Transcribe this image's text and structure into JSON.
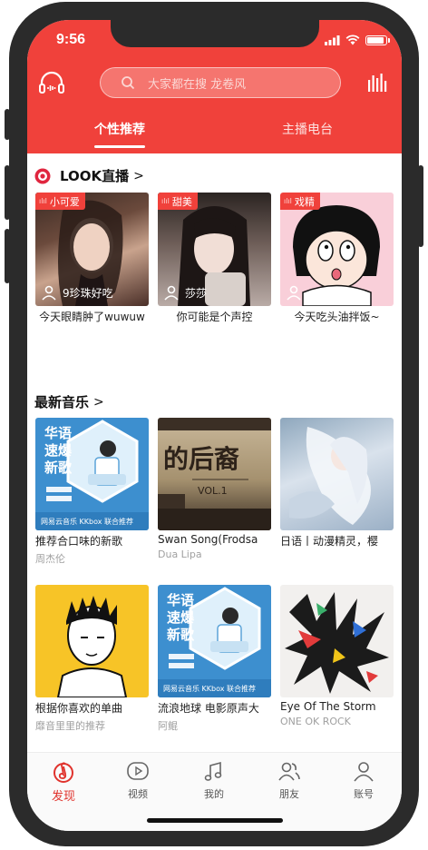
{
  "status_bar": {
    "time": "9:56"
  },
  "header": {
    "search_placeholder": "大家都在搜 龙卷风",
    "tabs": [
      {
        "label": "个性推荐",
        "active": true
      },
      {
        "label": "主播电台",
        "active": false
      }
    ]
  },
  "look": {
    "title": "LOOK直播",
    "arrow": ">",
    "cards": [
      {
        "tag": "小可爱",
        "name": "9珍珠好吃",
        "title": "今天眼睛肿了wuwuw"
      },
      {
        "tag": "甜美",
        "name": "莎莎",
        "title": "你可能是个声控"
      },
      {
        "tag": "戏精",
        "name": "",
        "title": "今天吃头油拌饭~"
      }
    ]
  },
  "music": {
    "title": "最新音乐",
    "arrow": ">",
    "cards": [
      {
        "title": "推荐合口味的新歌",
        "subtitle": "周杰伦",
        "cover": {
          "line1": "华语",
          "line2": "速爆",
          "line3": "新歌",
          "brand": "网易云音乐 KKbox 联合推荐"
        }
      },
      {
        "title": "Swan Song(Frodsa",
        "subtitle": "Dua Lipa",
        "cover": {
          "text1": "的后裔",
          "text2": "VOL.1"
        }
      },
      {
        "title": "日语丨动漫精灵，樱",
        "subtitle": ""
      },
      {
        "title": "根据你喜欢的单曲",
        "subtitle": "靡音里里的推荐"
      },
      {
        "title": "流浪地球 电影原声大",
        "subtitle": "阿鲲",
        "cover": {
          "line1": "华语",
          "line2": "速爆",
          "line3": "新歌",
          "brand": "网易云音乐 KKbox 联合推荐"
        }
      },
      {
        "title": "Eye Of The Storm",
        "subtitle": "ONE OK ROCK"
      }
    ]
  },
  "tabbar": {
    "items": [
      {
        "label": "发现",
        "icon": "netease-music-icon",
        "active": true
      },
      {
        "label": "视频",
        "icon": "video-icon",
        "active": false
      },
      {
        "label": "我的",
        "icon": "music-note-icon",
        "active": false
      },
      {
        "label": "朋友",
        "icon": "friends-icon",
        "active": false
      },
      {
        "label": "账号",
        "icon": "account-icon",
        "active": false
      }
    ]
  },
  "colors": {
    "brand_red": "#f0413b",
    "tab_active_red": "#e0332d"
  }
}
